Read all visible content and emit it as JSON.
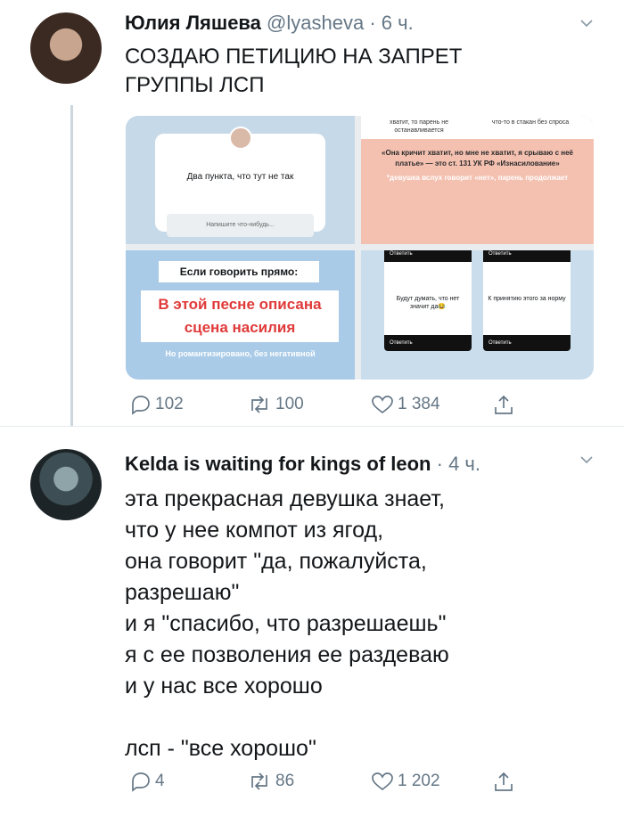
{
  "tweets": [
    {
      "name": "Юлия Ляшева",
      "handle": "@lyasheva",
      "sep": "·",
      "time": "6 ч.",
      "text_lines": [
        "СОЗДАЮ ПЕТИЦИЮ НА ЗАПРЕТ",
        "ГРУППЫ ЛСП"
      ],
      "media": {
        "q1": {
          "title": "Два пункта, что тут не так",
          "input": "Напишите что-нибудь..."
        },
        "q2": {
          "top_left": "хватит, то парень не останавливается",
          "top_right": "что-то в стакан без спроса",
          "main": "«Она кричит хватит, но мне не хватит, я срываю с неё платье» — это ст. 131 УК РФ «Изнасилование»",
          "sub": "*девушка вслух говорит «нет», парень продолжает"
        },
        "q3": {
          "heading": "Если говорить прямо:",
          "highlight": "В этой песне описана сцена насилия",
          "sub": "Но романтизировано, без негативной"
        },
        "q4": {
          "reply_label": "Ответить",
          "left_question": "Будут думать, что нет значит да😂",
          "right_question": "К принятию этого за норму"
        }
      },
      "counts": {
        "replies": "102",
        "retweets": "100",
        "likes": "1 384"
      }
    },
    {
      "name": "Kelda is waiting for kings of leon",
      "sep": "·",
      "time": "4 ч.",
      "text_lines": [
        "эта прекрасная девушка знает,",
        "что у нее компот из ягод,",
        "она говорит \"да, пожалуйста,",
        "разрешаю\"",
        "и я \"спасибо, что разрешаешь\"",
        "я с ее позволения ее раздеваю",
        "и у нас все хорошо",
        "",
        "лсп - \"все хорошо\""
      ],
      "counts": {
        "replies": "4",
        "retweets": "86",
        "likes": "1 202"
      }
    }
  ],
  "colors": {
    "text": "#14171a",
    "secondary": "#657786",
    "thread": "#ccd6dd",
    "divider": "#e6ecf0"
  },
  "icons": [
    "reply-icon",
    "retweet-icon",
    "like-icon",
    "share-icon",
    "chevron-down-icon"
  ]
}
